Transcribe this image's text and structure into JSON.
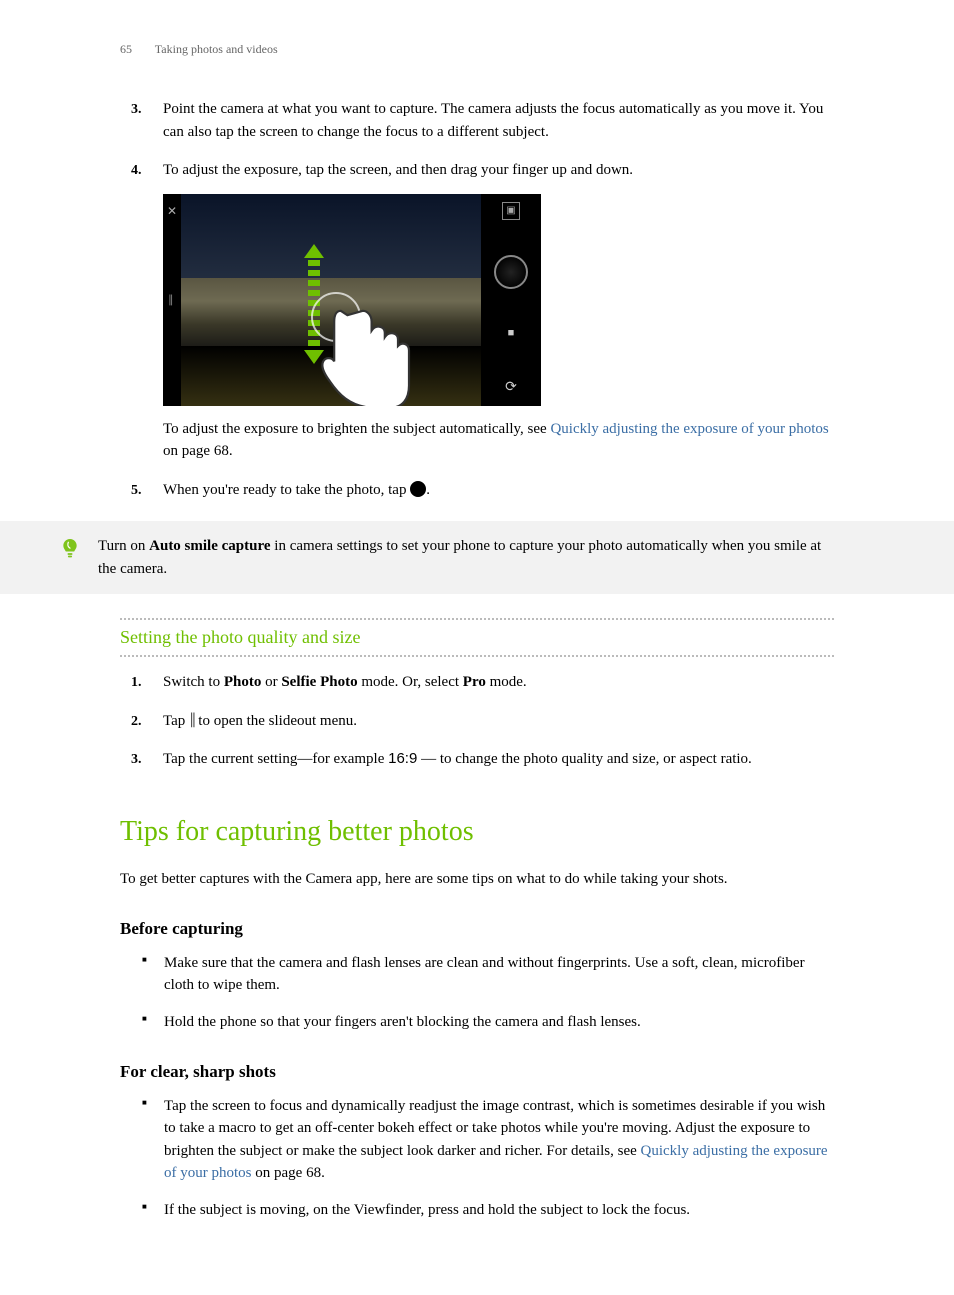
{
  "header": {
    "page_number": "65",
    "title": "Taking photos and videos"
  },
  "steps_a": {
    "start": 3,
    "items": [
      {
        "num": "3.",
        "text": "Point the camera at what you want to capture. The camera adjusts the focus automatically as you move it. You can also tap the screen to change the focus to a different subject."
      },
      {
        "num": "4.",
        "intro": "To adjust the exposure, tap the screen, and then drag your finger up and down.",
        "after_image_before_link": "To adjust the exposure to brighten the subject automatically, see ",
        "link": "Quickly adjusting the exposure of your photos",
        "after_link": " on page 68."
      },
      {
        "num": "5.",
        "before_icon": "When you're ready to take the photo, tap ",
        "after_icon": "."
      }
    ]
  },
  "tip": {
    "before_bold": "Turn on ",
    "bold": "Auto smile capture",
    "after_bold": " in camera settings to set your phone to capture your photo automatically when you smile at the camera."
  },
  "sub_heading": "Setting the photo quality and size",
  "steps_b": {
    "items": [
      {
        "num": "1.",
        "pre": "Switch to ",
        "b1": "Photo",
        "mid1": " or ",
        "b2": "Selfie Photo",
        "mid2": " mode. Or, select ",
        "b3": "Pro",
        "post": " mode."
      },
      {
        "num": "2.",
        "pre": "Tap ",
        "post": " to open the slideout menu."
      },
      {
        "num": "3.",
        "pre": "Tap the current setting—for example ",
        "ratio": "16:9",
        "post": " — to change the photo quality and size, or aspect ratio."
      }
    ]
  },
  "section2": {
    "title": "Tips for capturing better photos",
    "intro": "To get better captures with the Camera app, here are some tips on what to do while taking your shots.",
    "before": {
      "heading": "Before capturing",
      "bullets": [
        "Make sure that the camera and flash lenses are clean and without fingerprints. Use a soft, clean, microfiber cloth to wipe them.",
        "Hold the phone so that your fingers aren't blocking the camera and flash lenses."
      ]
    },
    "clear": {
      "heading": "For clear, sharp shots",
      "bullet1_pre": "Tap the screen to focus and dynamically readjust the image contrast, which is sometimes desirable if you wish to take a macro to get an off-center bokeh effect or take photos while you're moving. Adjust the exposure to brighten the subject or make the subject look darker and richer. For details, see ",
      "bullet1_link": "Quickly adjusting the exposure of your photos",
      "bullet1_post": " on page 68.",
      "bullet2": "If the subject is moving, on the Viewfinder, press and hold the subject to lock the focus."
    }
  }
}
